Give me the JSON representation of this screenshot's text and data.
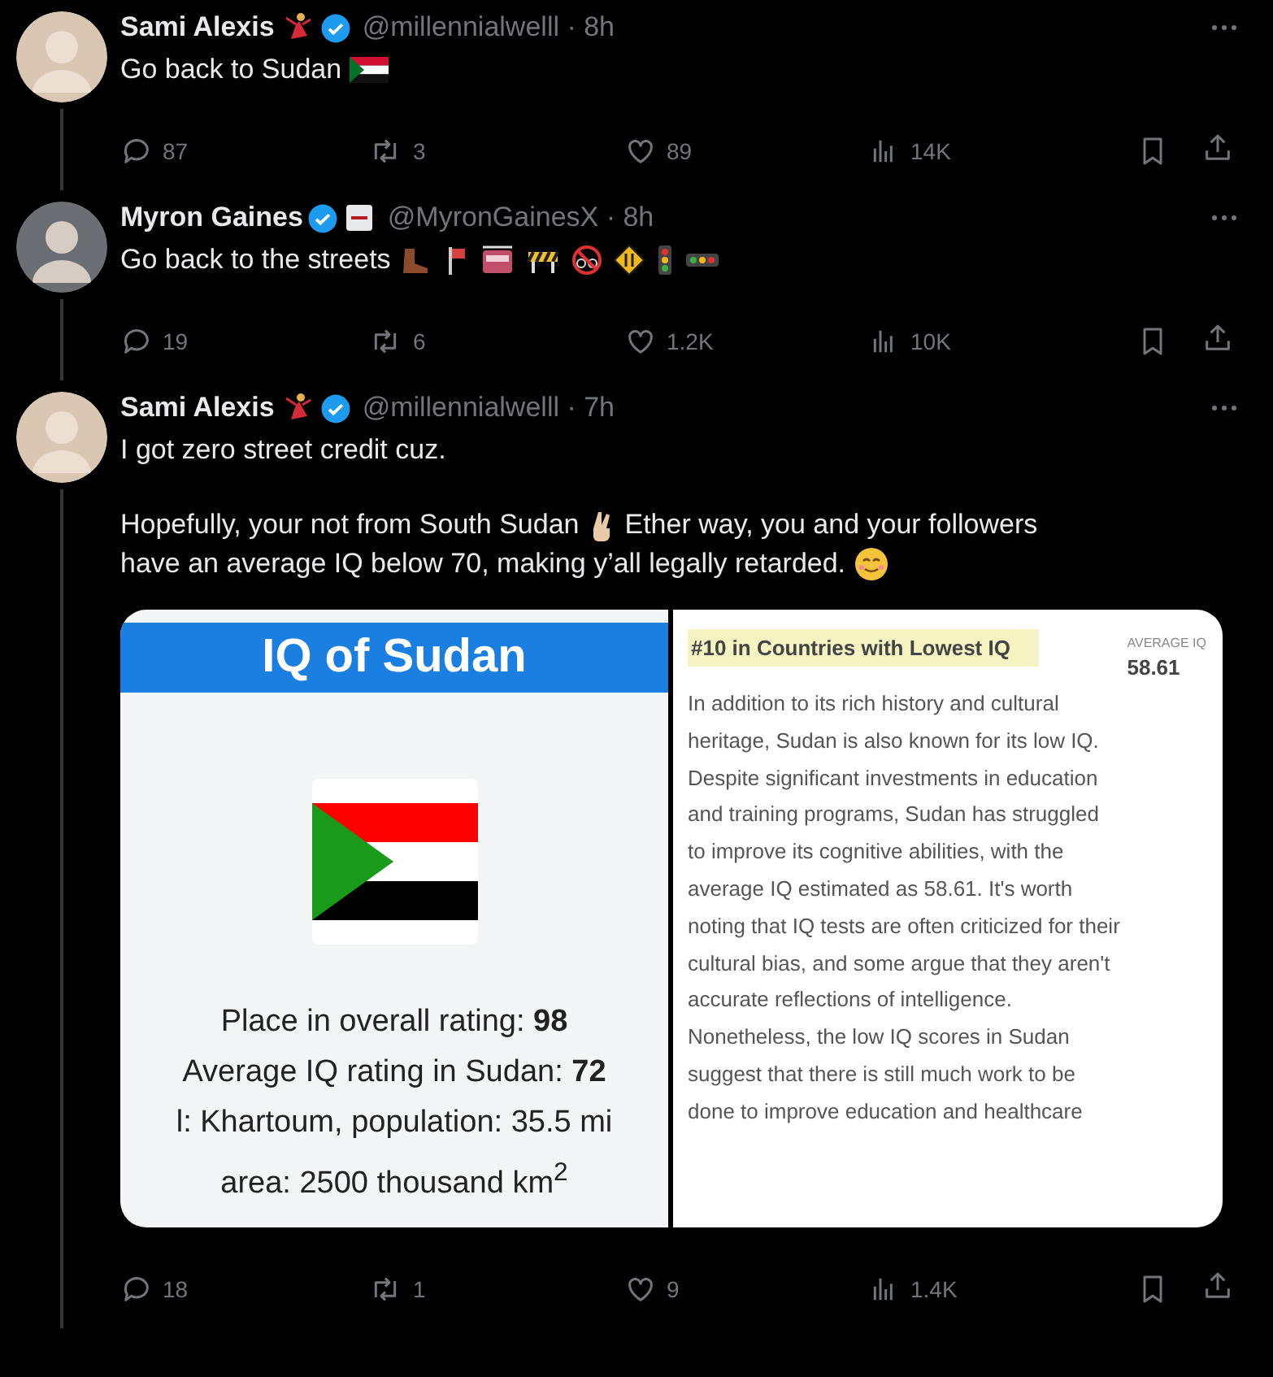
{
  "tweets": [
    {
      "name": "Sami Alexis",
      "verified": true,
      "meta": "@millennialwelll · 8h",
      "thread_line": true,
      "paragraphs": [
        [
          [
            "Go back to Sudan"
          ]
        ]
      ],
      "stats": {
        "replies": "87",
        "reposts": "3",
        "likes": "89",
        "views": "14K"
      }
    },
    {
      "name": "Myron Gaines",
      "verified": true,
      "meta": "@MyronGainesX · 8h",
      "thread_line": true,
      "paragraphs": [
        [
          [
            "Go back to the streets"
          ]
        ]
      ],
      "stats": {
        "replies": "19",
        "reposts": "6",
        "likes": "1.2K",
        "views": "10K"
      }
    },
    {
      "name": "Sami Alexis",
      "verified": true,
      "meta": "@millennialwelll · 7h",
      "thread_line": true,
      "paragraphs": [
        [
          [
            "I got zero street credit cuz."
          ]
        ],
        [
          [
            "Hopefully, your not from South Sudan",
            "Ether way, you and your followers"
          ],
          [
            "have an average IQ below 70, making y’all legally retarded."
          ]
        ]
      ],
      "media": {
        "left": {
          "title": "IQ of Sudan",
          "stats": [
            "Place in overall rating: **98**",
            "Average IQ rating in Sudan: **72**",
            "l: Khartoum, population: 35.5 mi",
            "area: 2500 thousand km$^{2}$"
          ]
        },
        "right": {
          "heading": "#10 in Countries with Lowest IQ",
          "label": "AVERAGE IQ",
          "value": "58.61",
          "body": "In addition to its rich history and cultural heritage, Sudan is also known for its low IQ. Despite significant investments in education and training programs, Sudan has struggled to improve its cognitive abilities, with the average IQ estimated as 58.61. It's worth noting that IQ tests are often criticized for their cultural bias, and some argue that they aren't accurate reflections of intelligence. Nonetheless, the low IQ scores in Sudan suggest that there is still much work to be done to improve education and healthcare"
        }
      },
      "stats": {
        "replies": "18",
        "reposts": "1",
        "likes": "9",
        "views": "1.4K"
      }
    }
  ]
}
